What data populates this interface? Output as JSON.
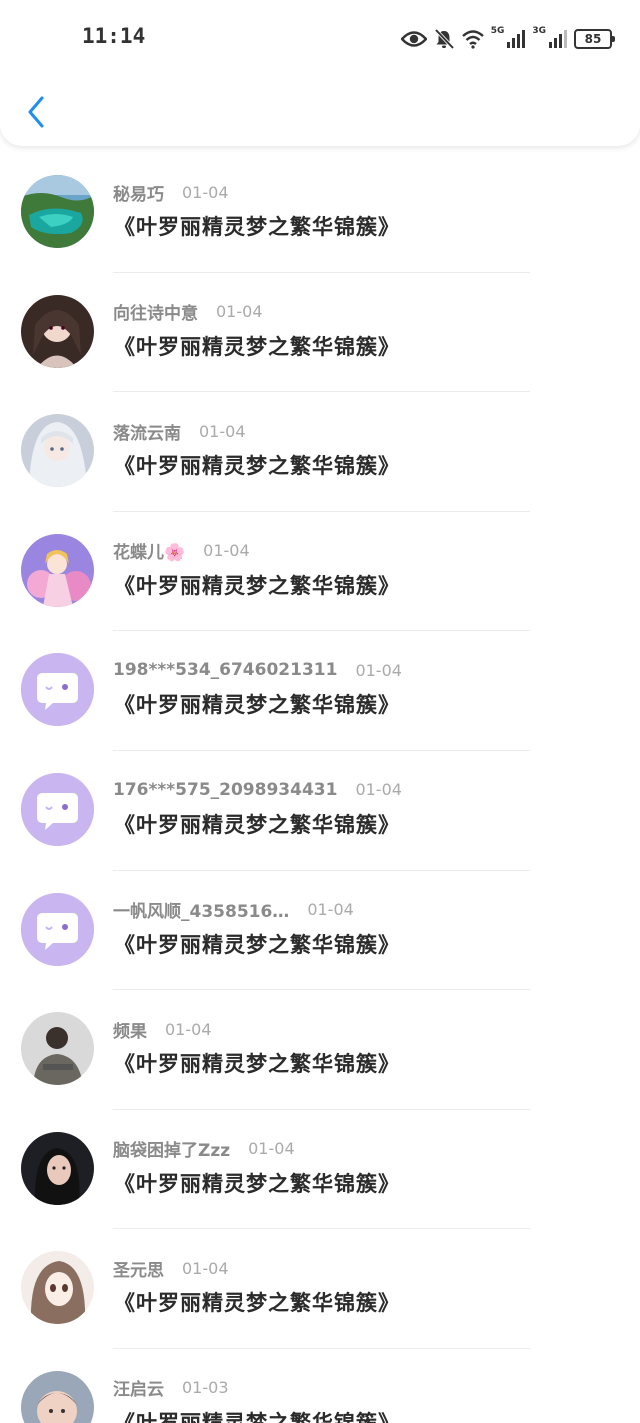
{
  "status_bar": {
    "time": "11:14",
    "net1": "5G",
    "net2": "3G",
    "battery": "85",
    "icons": [
      "eye-icon",
      "bell-muted-icon",
      "wifi-icon",
      "signal-icon",
      "signal-icon",
      "battery-icon"
    ]
  },
  "header": {
    "back_icon": "chevron-left-icon",
    "accent": "#1e8ef0"
  },
  "avatar_default_color": "#c9b6f0",
  "items": [
    {
      "name": "秘易巧",
      "date": "01-04",
      "title": "《叶罗丽精灵梦之繁华锦簇》",
      "avatar": "photo-lake"
    },
    {
      "name": "向往诗中意",
      "date": "01-04",
      "title": "《叶罗丽精灵梦之繁华锦簇》",
      "avatar": "photo-doll"
    },
    {
      "name": "落流云南",
      "date": "01-04",
      "title": "《叶罗丽精灵梦之繁华锦簇》",
      "avatar": "photo-anime-white"
    },
    {
      "name": "花蝶儿🌸",
      "date": "01-04",
      "title": "《叶罗丽精灵梦之繁华锦簇》",
      "avatar": "photo-anime-pink"
    },
    {
      "name": "198***534_6746021311",
      "date": "01-04",
      "title": "《叶罗丽精灵梦之繁华锦簇》",
      "avatar": "default-chat"
    },
    {
      "name": "176***575_2098934431",
      "date": "01-04",
      "title": "《叶罗丽精灵梦之繁华锦簇》",
      "avatar": "default-chat"
    },
    {
      "name": "一帆风顺_4358516…",
      "date": "01-04",
      "title": "《叶罗丽精灵梦之繁华锦簇》",
      "avatar": "default-chat"
    },
    {
      "name": "频果",
      "date": "01-04",
      "title": "《叶罗丽精灵梦之繁华锦簇》",
      "avatar": "photo-person-back"
    },
    {
      "name": "脑袋困掉了Zzz",
      "date": "01-04",
      "title": "《叶罗丽精灵梦之繁华锦簇》",
      "avatar": "photo-girl-dark"
    },
    {
      "name": "圣元思",
      "date": "01-04",
      "title": "《叶罗丽精灵梦之繁华锦簇》",
      "avatar": "photo-manga"
    },
    {
      "name": "汪启云",
      "date": "01-03",
      "title": "《叶罗丽精灵梦之繁华锦簇》",
      "avatar": "photo-baby"
    }
  ]
}
